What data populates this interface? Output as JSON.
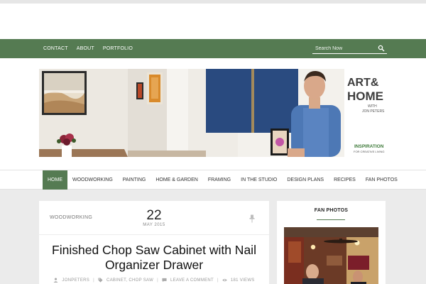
{
  "top_nav": {
    "links": [
      "CONTACT",
      "ABOUT",
      "PORTFOLIO"
    ]
  },
  "search": {
    "placeholder": "Search Now"
  },
  "banner": {
    "logo_line1": "ART&",
    "logo_line2": "HOME",
    "logo_with": "WITH",
    "logo_name": "JON PETERS",
    "tagline_line1": "INSPIRATION",
    "tagline_line2": "FOR CREATIVE LIVING"
  },
  "main_nav": {
    "items": [
      "HOME",
      "WOODWORKING",
      "PAINTING",
      "HOME & GARDEN",
      "FRAMING",
      "IN THE STUDIO",
      "DESIGN PLANS",
      "RECIPES",
      "FAN PHOTOS"
    ],
    "active": "HOME"
  },
  "post": {
    "category": "WOODWORKING",
    "day": "22",
    "month_year": "MAY 2015",
    "title": "Finished Chop Saw Cabinet with Nail Organizer Drawer",
    "author": "JONPETERS",
    "tags": "CABINET, CHOP SAW",
    "comments": "LEAVE A COMMENT",
    "views": "181 VIEWS"
  },
  "sidebar": {
    "widget_title": "FAN PHOTOS"
  },
  "colors": {
    "accent": "#557b52",
    "logo_dark": "#3d3d3d",
    "logo_green": "#3e7a3a",
    "page_bg": "#ebebeb"
  }
}
